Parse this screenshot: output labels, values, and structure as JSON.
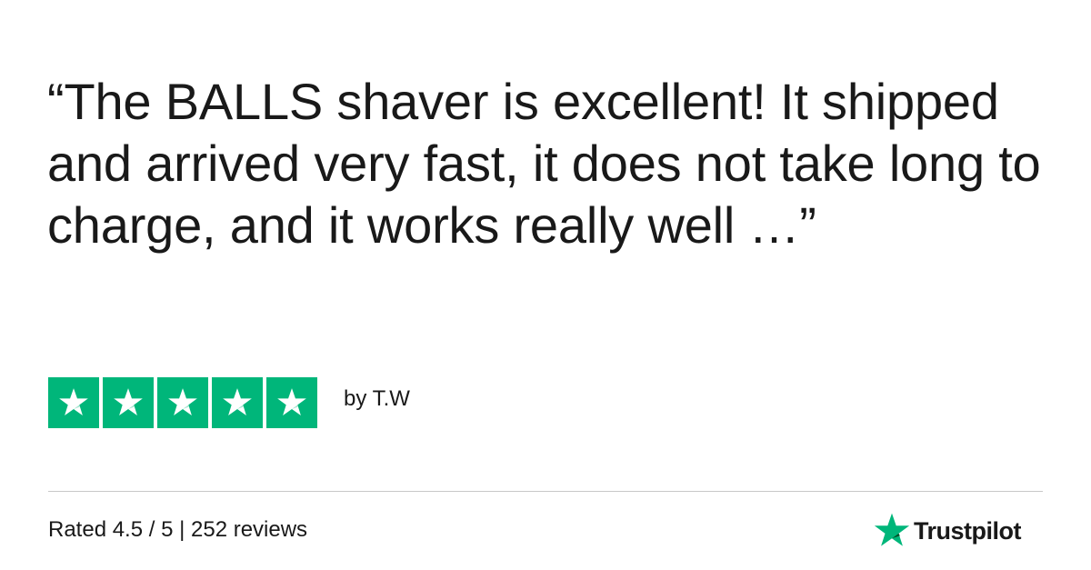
{
  "review": {
    "quote": "“The BALLS shaver is excellent! It shipped and arrived very fast, it does not take long to charge, and it works really well …”",
    "author": "by T.W",
    "stars": 5,
    "star_color": "#00b67a",
    "star_icon": "star-icon"
  },
  "footer": {
    "summary": "Rated 4.5 / 5 | 252 reviews",
    "brand_name": "Trustpilot",
    "brand_icon": "trustpilot-star-icon",
    "brand_star_color": "#00b67a",
    "divider_color": "#c8c8c8"
  }
}
